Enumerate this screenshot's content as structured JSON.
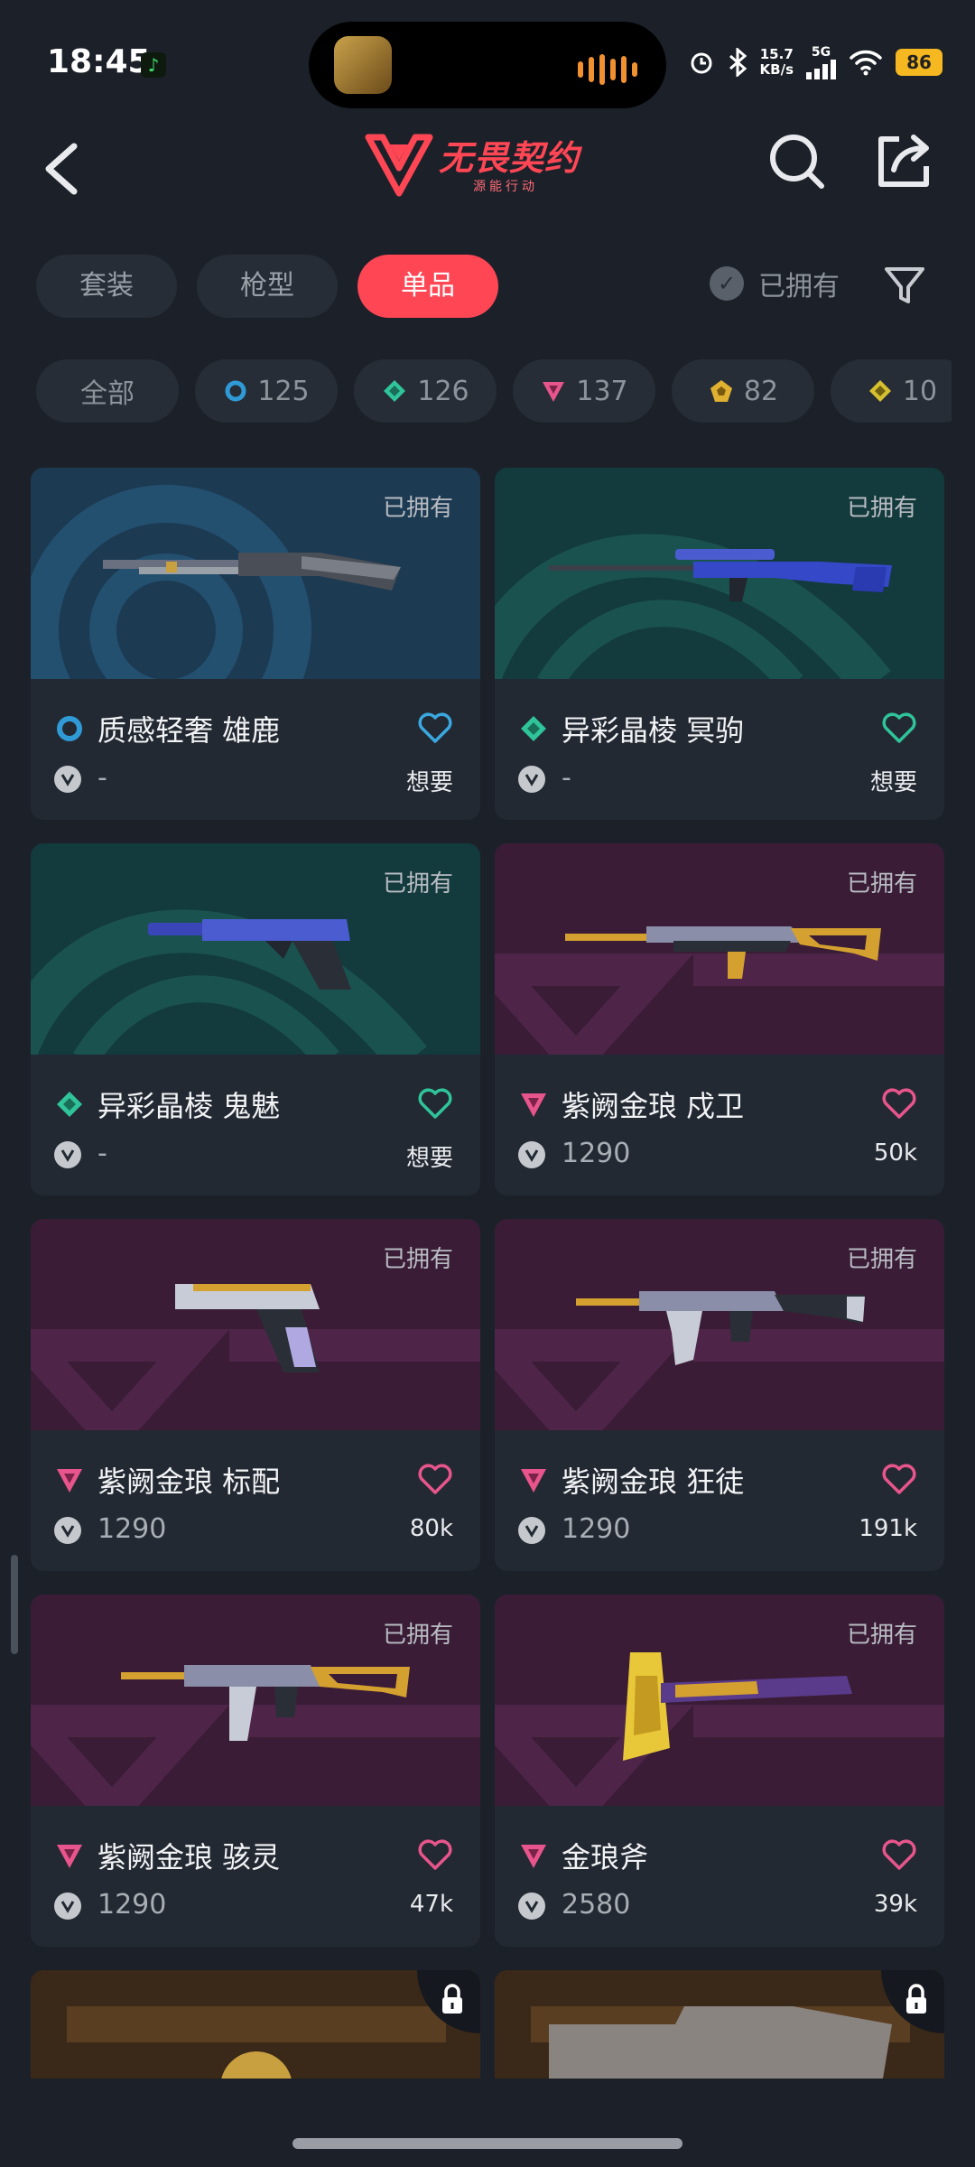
{
  "status": {
    "time": "18:45",
    "net_speed_top": "15.7",
    "net_speed_bottom": "KB/s",
    "network": "5G",
    "battery": "86"
  },
  "header": {
    "logo_title": "无畏契约",
    "logo_subtitle": "源能行动"
  },
  "tabs": [
    {
      "label": "套装",
      "active": false
    },
    {
      "label": "枪型",
      "active": false
    },
    {
      "label": "单品",
      "active": true
    }
  ],
  "owned_filter_label": "已拥有",
  "rarity_chips": [
    {
      "label": "全部",
      "icon": "",
      "color": ""
    },
    {
      "label": "125",
      "icon": "ring-icon",
      "color": "#2f9ad6"
    },
    {
      "label": "126",
      "icon": "diamond-icon",
      "color": "#2fc49a"
    },
    {
      "label": "137",
      "icon": "triangle-icon",
      "color": "#e8558c"
    },
    {
      "label": "82",
      "icon": "pentagon-icon",
      "color": "#e0b030"
    },
    {
      "label": "10",
      "icon": "diamond-icon",
      "color": "#d6c030"
    }
  ],
  "cards": [
    {
      "name": "质感轻奢 雄鹿",
      "rarity": "ring",
      "price": "-",
      "wants": "想要",
      "owned": "已拥有",
      "bg": "blue",
      "heart_color": "#3aa8e0"
    },
    {
      "name": "异彩晶棱 冥驹",
      "rarity": "diamond",
      "price": "-",
      "wants": "想要",
      "owned": "已拥有",
      "bg": "teal",
      "heart_color": "#2fc49a"
    },
    {
      "name": "异彩晶棱 鬼魅",
      "rarity": "diamond",
      "price": "-",
      "wants": "想要",
      "owned": "已拥有",
      "bg": "teal",
      "heart_color": "#2fc49a"
    },
    {
      "name": "紫阙金琅 戍卫",
      "rarity": "triangle",
      "price": "1290",
      "wants": "50k",
      "owned": "已拥有",
      "bg": "purple",
      "heart_color": "#e8558c"
    },
    {
      "name": "紫阙金琅 标配",
      "rarity": "triangle",
      "price": "1290",
      "wants": "80k",
      "owned": "已拥有",
      "bg": "purple",
      "heart_color": "#e8558c"
    },
    {
      "name": "紫阙金琅 狂徒",
      "rarity": "triangle",
      "price": "1290",
      "wants": "191k",
      "owned": "已拥有",
      "bg": "purple",
      "heart_color": "#e8558c"
    },
    {
      "name": "紫阙金琅 骇灵",
      "rarity": "triangle",
      "price": "1290",
      "wants": "47k",
      "owned": "已拥有",
      "bg": "purple",
      "heart_color": "#e8558c"
    },
    {
      "name": "金琅斧",
      "rarity": "triangle",
      "price": "2580",
      "wants": "39k",
      "owned": "已拥有",
      "bg": "purple",
      "heart_color": "#e8558c"
    }
  ],
  "colors": {
    "accent": "#ff4655",
    "background": "#1c2129",
    "card": "#232932"
  }
}
